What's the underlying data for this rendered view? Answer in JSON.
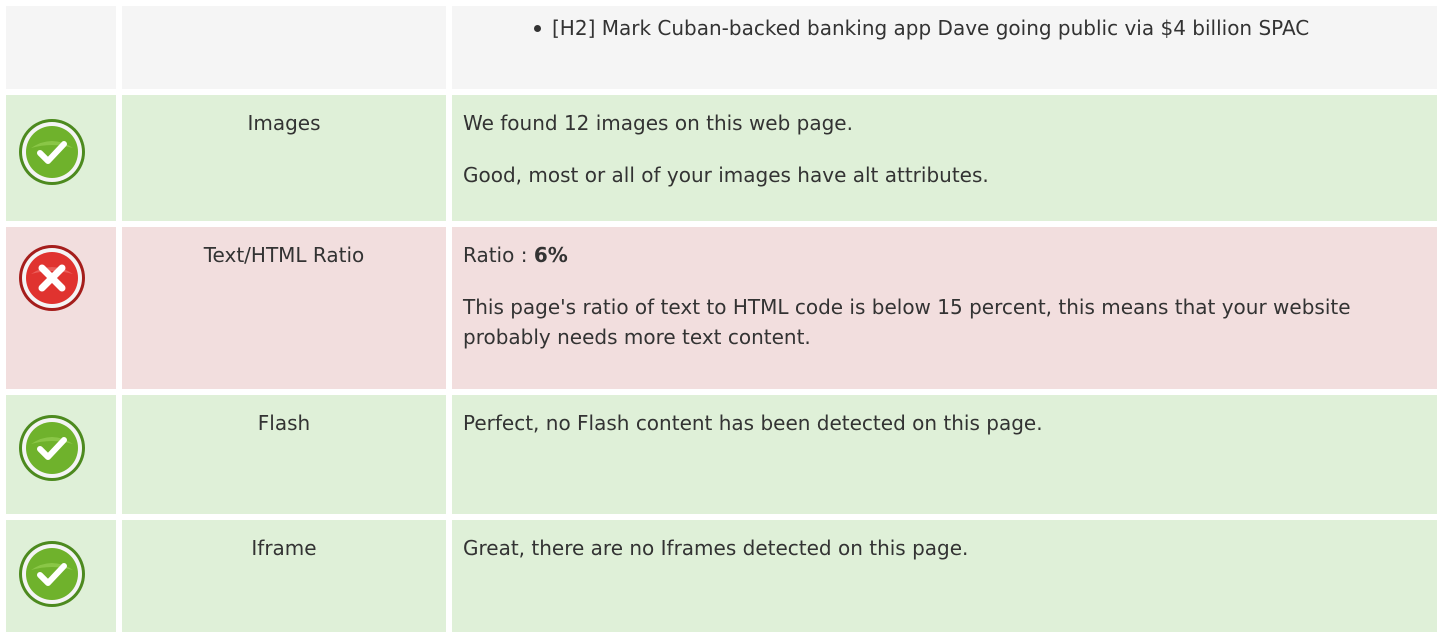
{
  "headings_row": {
    "items": [
      "[H2] Mark Cuban-backed banking app Dave going public via $4 billion SPAC"
    ]
  },
  "rows": [
    {
      "status": "pass",
      "label": "Images",
      "lines": [
        "We found 12 images on this web page.",
        "Good, most or all of your images have alt attributes."
      ]
    },
    {
      "status": "fail",
      "label": "Text/HTML Ratio",
      "ratio_prefix": "Ratio : ",
      "ratio_value": "6%",
      "line2": "This page's ratio of text to HTML code is below 15 percent, this means that your website probably needs more text content."
    },
    {
      "status": "pass",
      "label": "Flash",
      "lines": [
        "Perfect, no Flash content has been detected on this page."
      ]
    },
    {
      "status": "pass",
      "label": "Iframe",
      "lines": [
        "Great, there are no Iframes detected on this page."
      ]
    }
  ],
  "icons": {
    "pass": "check-circle-icon",
    "fail": "x-circle-icon"
  },
  "colors": {
    "pass_row": "#dff0d8",
    "fail_row": "#f2dede",
    "plain_row": "#f5f5f5",
    "pass_icon": "#6fb22c",
    "fail_icon": "#e0332f"
  }
}
